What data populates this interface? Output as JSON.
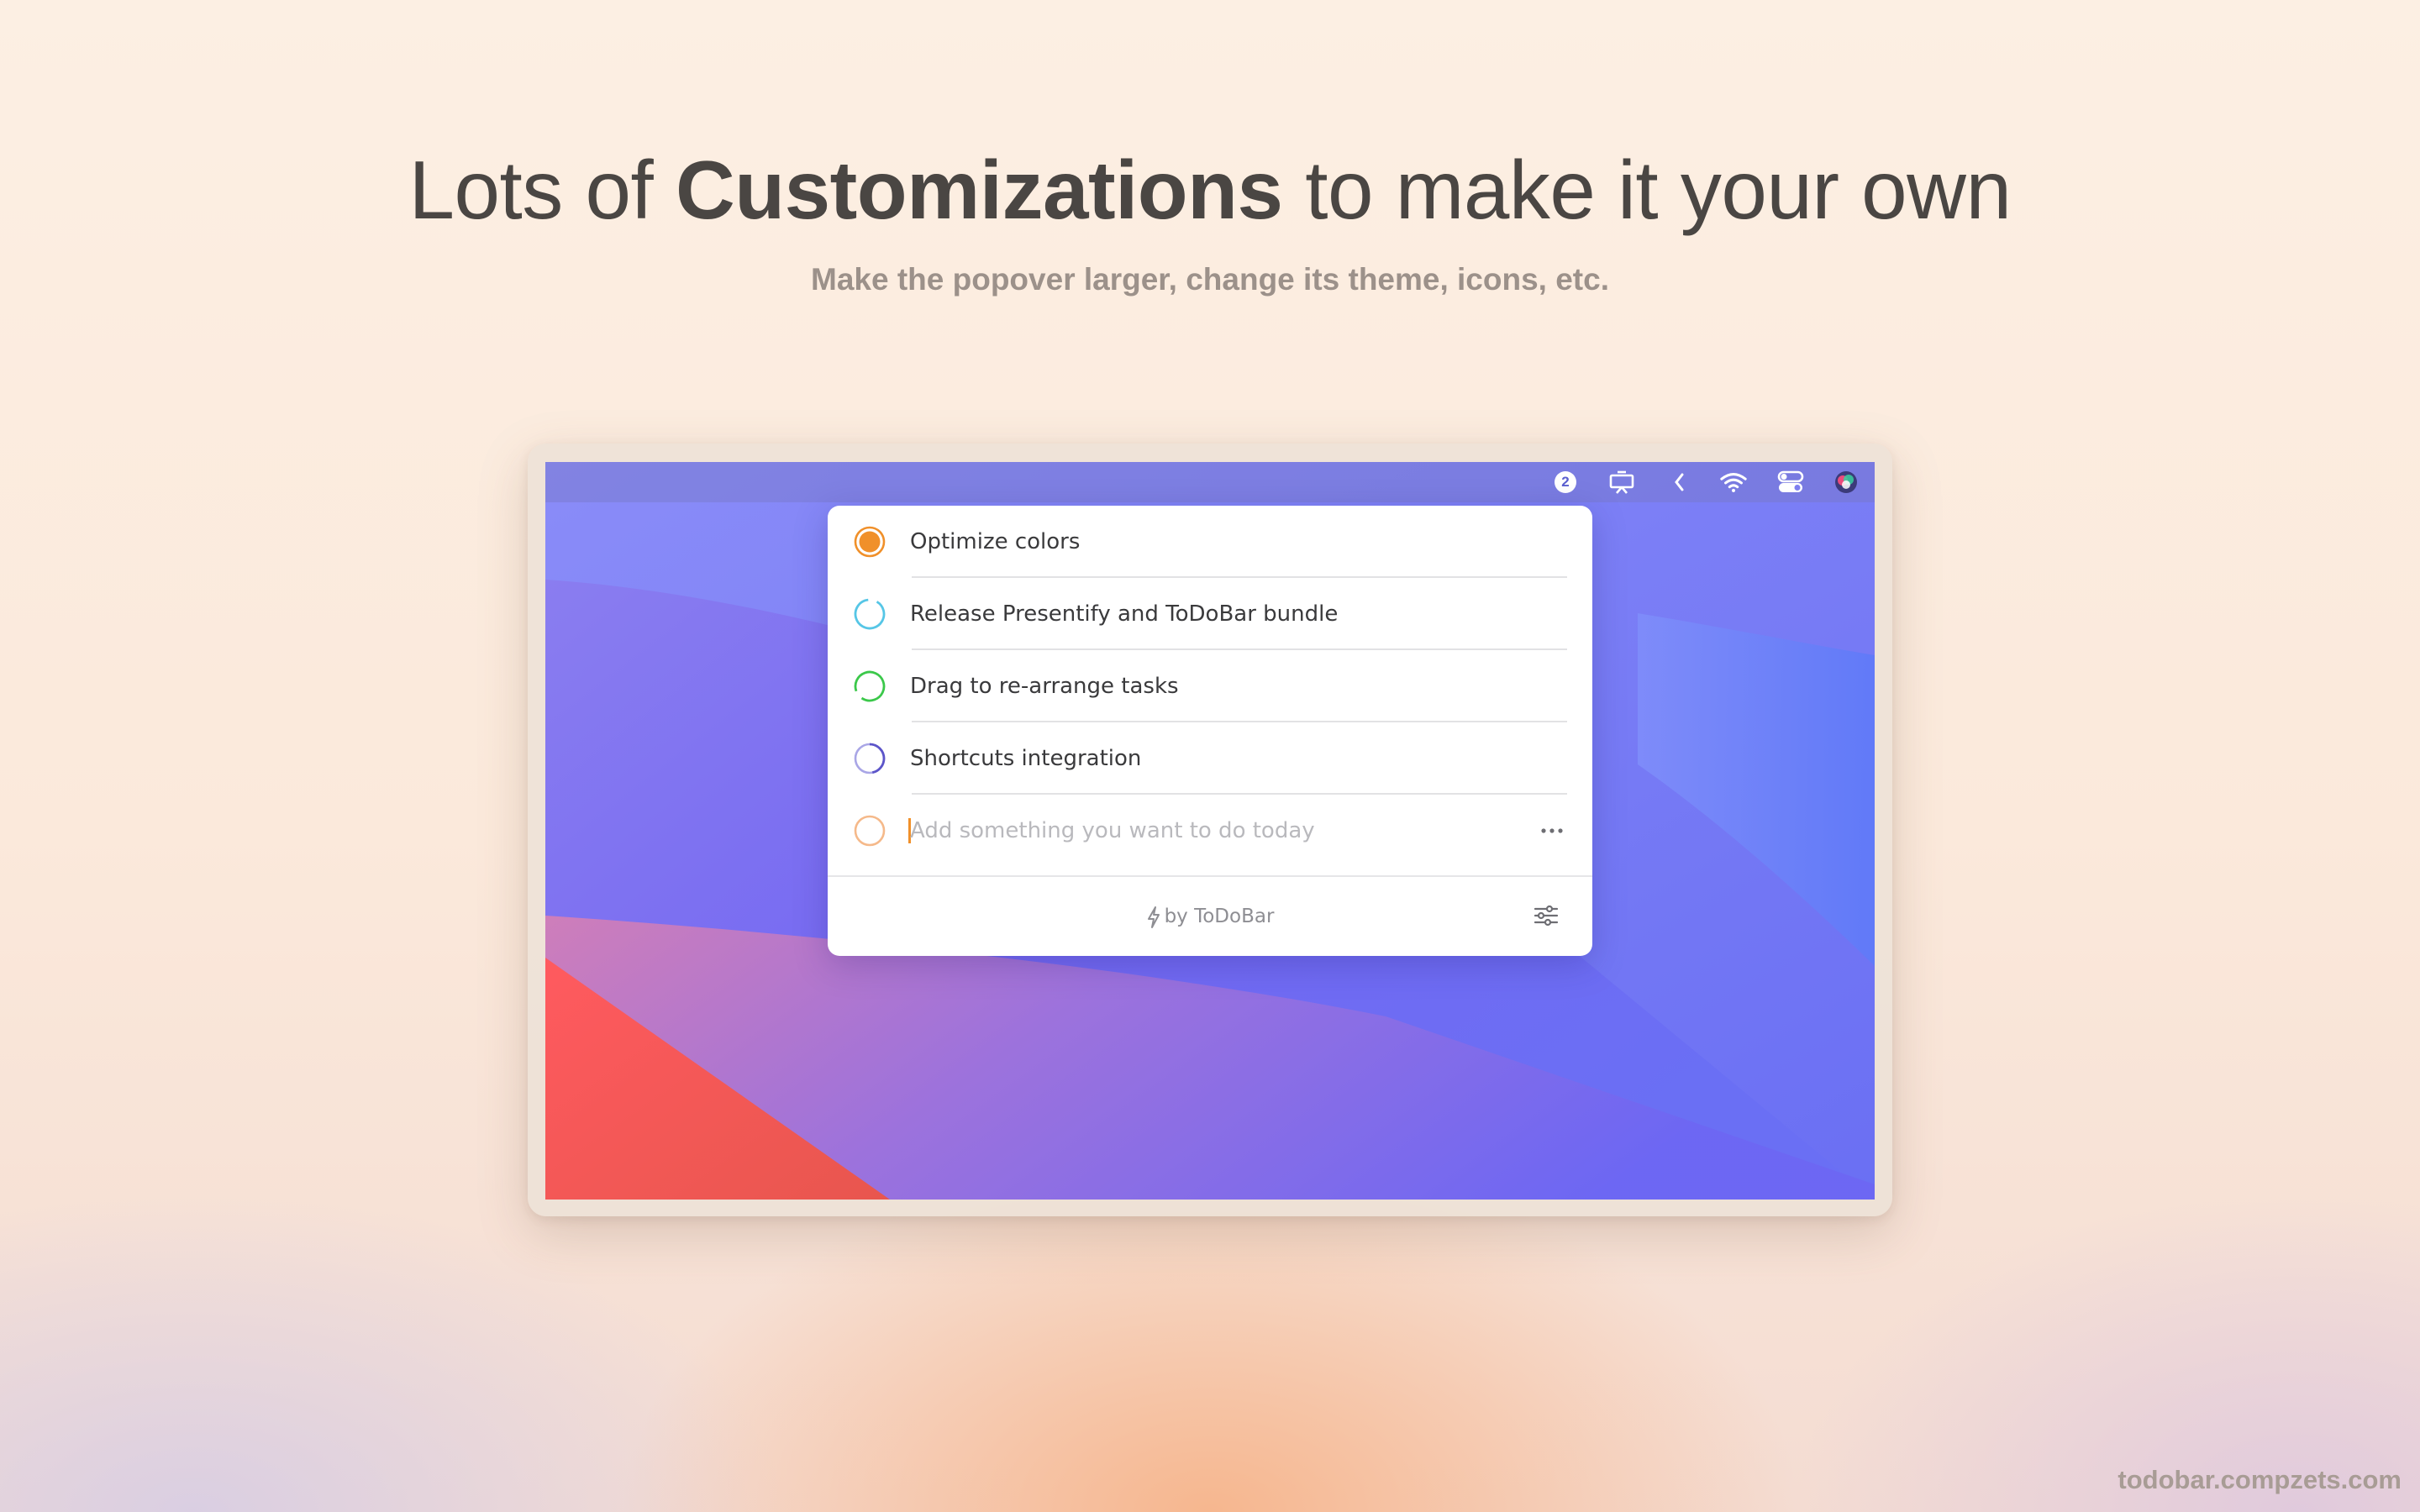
{
  "marketing": {
    "headline_pre": "Lots of ",
    "headline_bold": "Customizations",
    "headline_post": " to make it your own",
    "subheadline": "Make the popover larger, change its theme, icons, etc.",
    "website": "todobar.compzets.com"
  },
  "menubar": {
    "badge_count": "2",
    "icons": [
      "notification-badge-icon",
      "presentation-icon",
      "chevron-left-icon",
      "wifi-icon",
      "control-center-icon",
      "siri-icon"
    ]
  },
  "popover": {
    "tasks": [
      {
        "label": "Optimize colors",
        "ring_color": "#f0902a",
        "state": "filled"
      },
      {
        "label": "Release Presentify and ToDoBar bundle",
        "ring_color": "#56c6e6",
        "state": "partial"
      },
      {
        "label": "Drag to re-arrange tasks",
        "ring_color": "#3bc84a",
        "state": "partial"
      },
      {
        "label": "Shortcuts integration",
        "ring_color": "#5c55c9",
        "state": "partial"
      }
    ],
    "new_task": {
      "placeholder": "Add something you want to do today",
      "ring_color": "#f5b98a"
    },
    "footer": {
      "byline": "by ToDoBar"
    }
  },
  "colors": {
    "accent": "#f0902a"
  }
}
